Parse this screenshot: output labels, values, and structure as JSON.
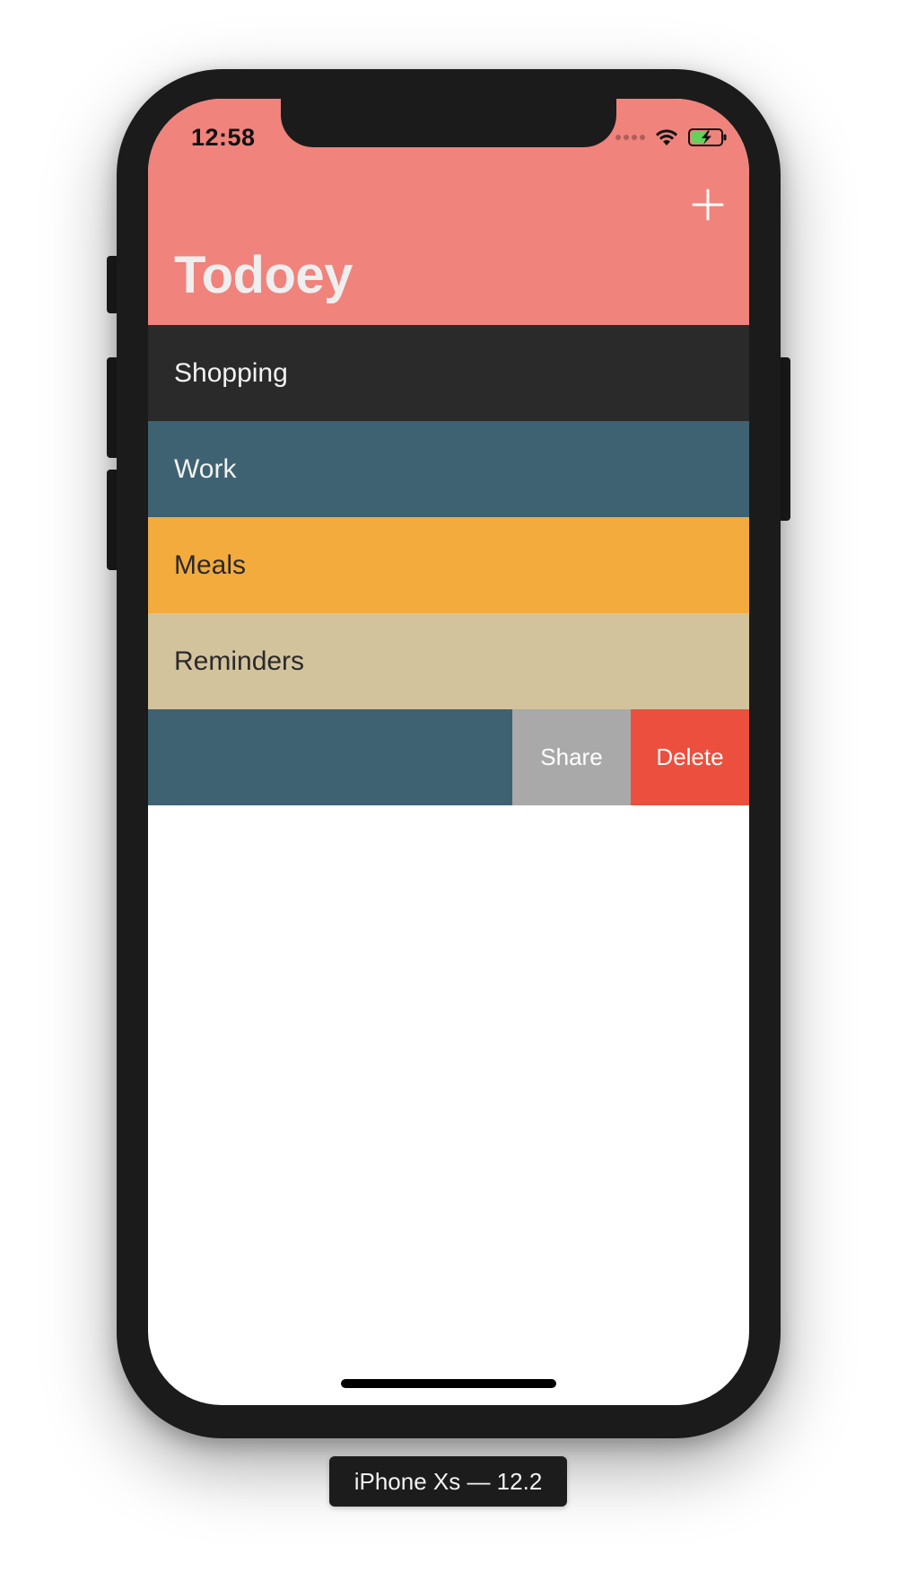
{
  "status_bar": {
    "time": "12:58",
    "signal_icon": "signal-dots-icon",
    "wifi_icon": "wifi-icon",
    "battery_icon": "battery-charging-icon"
  },
  "nav": {
    "title": "Todoey",
    "add_icon": "plus-icon",
    "background": "#F0837C",
    "title_color": "#EFEFEF"
  },
  "categories": [
    {
      "name": "Shopping",
      "background": "#2A2A2A",
      "text_color": "#F2F2F2"
    },
    {
      "name": "Work",
      "background": "#3E6271",
      "text_color": "#F2F2F2"
    },
    {
      "name": "Meals",
      "background": "#F3AB3D",
      "text_color": "#2A2A2A"
    },
    {
      "name": "Reminders",
      "background": "#D3C39D",
      "text_color": "#2A2A2A"
    }
  ],
  "swiped_row": {
    "background": "#3E6271",
    "actions": [
      {
        "label": "Share",
        "background": "#A9A9A9"
      },
      {
        "label": "Delete",
        "background": "#EC4F3E"
      }
    ]
  },
  "device_label": "iPhone Xs — 12.2"
}
